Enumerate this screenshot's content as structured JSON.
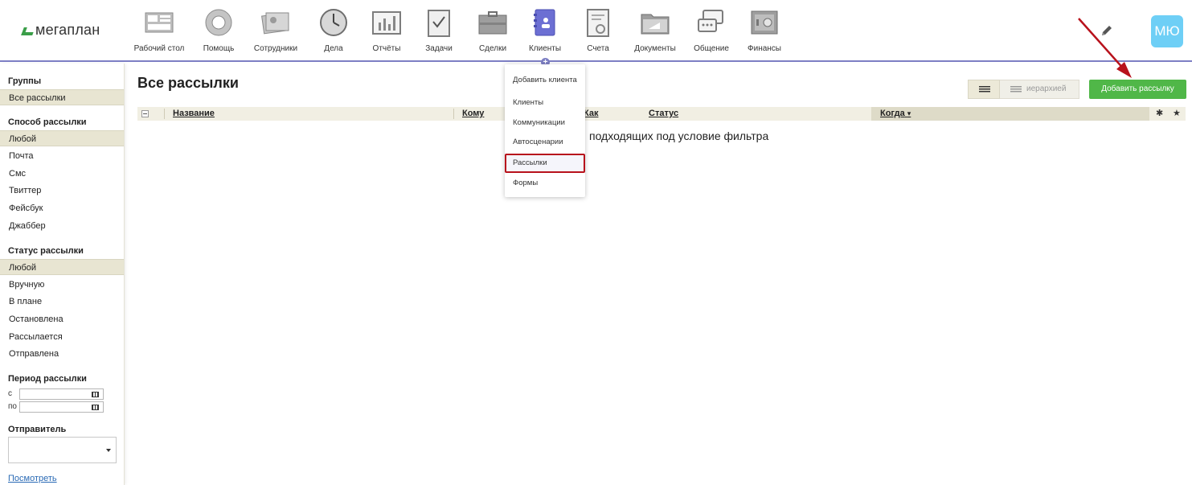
{
  "header": {
    "logo": "мегаплан",
    "nav": [
      {
        "label": "Рабочий стол",
        "icon": "desktop-icon"
      },
      {
        "label": "Помощь",
        "icon": "lifebuoy-icon"
      },
      {
        "label": "Сотрудники",
        "icon": "employees-icon"
      },
      {
        "label": "Дела",
        "icon": "clock-icon"
      },
      {
        "label": "Отчёты",
        "icon": "chart-icon"
      },
      {
        "label": "Задачи",
        "icon": "clipboard-icon"
      },
      {
        "label": "Сделки",
        "icon": "briefcase-icon"
      },
      {
        "label": "Клиенты",
        "icon": "contacts-book-icon"
      },
      {
        "label": "Счета",
        "icon": "invoice-icon"
      },
      {
        "label": "Документы",
        "icon": "folder-icon"
      },
      {
        "label": "Общение",
        "icon": "chat-icon"
      },
      {
        "label": "Финансы",
        "icon": "safe-icon"
      }
    ],
    "active_nav": "Клиенты",
    "avatar_initials": "МЮ"
  },
  "sidebar": {
    "groups_title": "Группы",
    "groups": [
      "Все рассылки"
    ],
    "method_title": "Способ рассылки",
    "methods": [
      "Любой",
      "Почта",
      "Смс",
      "Твиттер",
      "Фейсбук",
      "Джаббер"
    ],
    "status_title": "Статус рассылки",
    "statuses": [
      "Любой",
      "Вручную",
      "В плане",
      "Остановлена",
      "Рассылается",
      "Отправлена"
    ],
    "period_title": "Период рассылки",
    "period_from_label": "с",
    "period_to_label": "по",
    "sender_title": "Отправитель",
    "show_link": "Посмотреть"
  },
  "main": {
    "title": "Все рассылки",
    "view_hierarchy_label": "иерархией",
    "add_button": "Добавить рассылку",
    "columns": [
      "Название",
      "Кому",
      "Как",
      "Статус",
      "Когда"
    ],
    "sorted_column": "Когда",
    "empty_message": "подходящих под условие фильтра"
  },
  "dropdown": {
    "items": [
      "Добавить клиента",
      "Клиенты",
      "Коммуникации",
      "Автосценарии",
      "Рассылки",
      "Формы"
    ],
    "highlighted": "Рассылки"
  },
  "colors": {
    "accent": "#7d7fc4",
    "add_button": "#50b748",
    "highlight_border": "#b8121c",
    "avatar": "#6ecff6"
  }
}
